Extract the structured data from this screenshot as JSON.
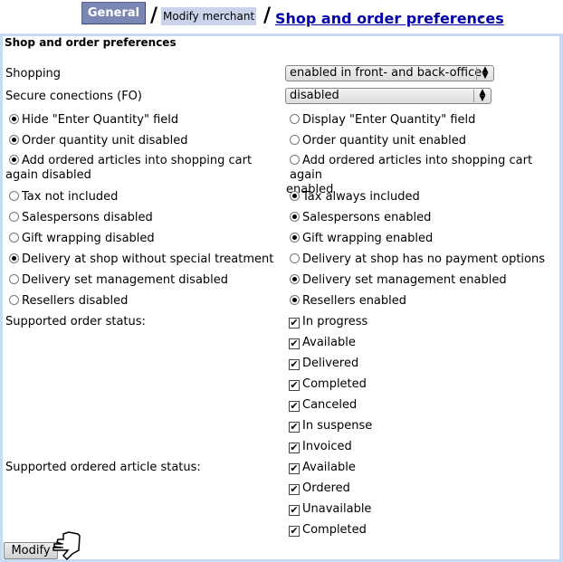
{
  "breadcrumb": {
    "tab_general": "General",
    "separator": "/",
    "modify_merchant": "Modify merchant",
    "current_link": "Shop and order preferences",
    "colon": ":"
  },
  "panel": {
    "title": "Shop and order preferences",
    "shopping": {
      "label": "Shopping",
      "value": "enabled in front- and back-office"
    },
    "secure": {
      "label": "Secure conections (FO)",
      "value": "disabled"
    },
    "radio_rows": [
      {
        "left": {
          "label": "Hide \"Enter Quantity\" field",
          "checked": true
        },
        "right": {
          "label": "Display \"Enter Quantity\" field",
          "checked": false
        }
      },
      {
        "left": {
          "label": "Order quantity unit disabled",
          "checked": true
        },
        "right": {
          "label": "Order quantity unit enabled",
          "checked": false
        }
      },
      {
        "left": {
          "label": "Add ordered articles into shopping cart",
          "label2": "again disabled",
          "checked": true
        },
        "right": {
          "label": "Add ordered articles into shopping cart again",
          "label2": "enabled",
          "checked": false
        }
      },
      {
        "left": {
          "label": "Tax not included",
          "checked": false
        },
        "right": {
          "label": "Tax always included",
          "checked": true
        }
      },
      {
        "left": {
          "label": "Salespersons disabled",
          "checked": false
        },
        "right": {
          "label": "Salespersons enabled",
          "checked": true
        }
      },
      {
        "left": {
          "label": "Gift wrapping disabled",
          "checked": false
        },
        "right": {
          "label": "Gift wrapping enabled",
          "checked": true
        }
      },
      {
        "left": {
          "label": "Delivery at shop without special treatment",
          "checked": true
        },
        "right": {
          "label": "Delivery at shop has no payment options",
          "checked": false
        }
      },
      {
        "left": {
          "label": "Delivery set management disabled",
          "checked": false
        },
        "right": {
          "label": "Delivery set management enabled",
          "checked": true
        }
      },
      {
        "left": {
          "label": "Resellers disabled",
          "checked": false
        },
        "right": {
          "label": "Resellers enabled",
          "checked": true
        }
      }
    ],
    "order_status": {
      "label": "Supported order status:",
      "options": [
        {
          "label": "In progress",
          "checked": true
        },
        {
          "label": "Available",
          "checked": true
        },
        {
          "label": "Delivered",
          "checked": true
        },
        {
          "label": "Completed",
          "checked": true
        },
        {
          "label": "Canceled",
          "checked": true
        },
        {
          "label": "In suspense",
          "checked": true
        },
        {
          "label": "Invoiced",
          "checked": true
        }
      ]
    },
    "article_status": {
      "label": "Supported ordered article status:",
      "options": [
        {
          "label": "Available",
          "checked": true
        },
        {
          "label": "Ordered",
          "checked": true
        },
        {
          "label": "Unavailable",
          "checked": true
        },
        {
          "label": "Completed",
          "checked": true
        }
      ]
    },
    "modify_label": "Modify",
    "check_glyph": "✔",
    "select_arrows": "▲▼"
  }
}
